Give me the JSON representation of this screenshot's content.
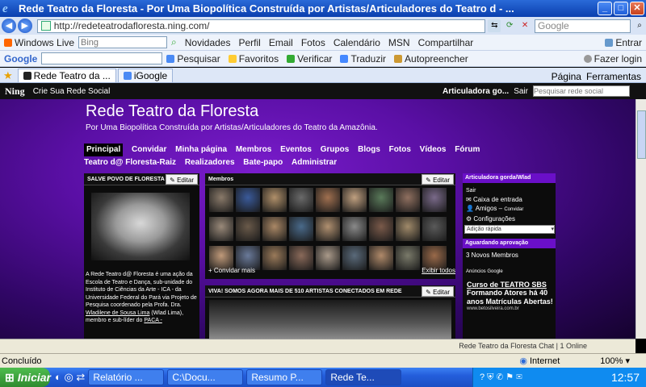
{
  "window": {
    "title": "Rede Teatro da Floresta - Por Uma Biopolítica Construída por Artistas/Articuladores do Teatro d - ..."
  },
  "address": {
    "url": "http://redeteatrodafloresta.ning.com/",
    "search_placeholder": "Google"
  },
  "toolbar1": {
    "brand": "Windows Live",
    "search_value": "Bing",
    "items": [
      "Novidades",
      "Perfil",
      "Email",
      "Fotos",
      "Calendário",
      "MSN",
      "Compartilhar"
    ],
    "enter": "Entrar"
  },
  "toolbar2": {
    "brand": "Google",
    "items": [
      "Pesquisar",
      "Favoritos",
      "Verificar",
      "Traduzir",
      "Autopreencher"
    ],
    "login": "Fazer login"
  },
  "tabs": [
    {
      "label": "Rede Teatro da ..."
    },
    {
      "label": "iGoogle"
    }
  ],
  "tab_tools": {
    "page": "Página",
    "tools": "Ferramentas"
  },
  "ningbar": {
    "logo": "Ning",
    "create": "Crie Sua Rede Social",
    "user": "Articuladora go...",
    "exit": "Sair",
    "search_placeholder": "Pesquisar rede social"
  },
  "site": {
    "title": "Rede Teatro da Floresta",
    "subtitle": "Por Uma Biopolítica Construída por Artistas/Articuladores do Teatro da Amazônia."
  },
  "nav": [
    "Principal",
    "Convidar",
    "Minha página",
    "Membros",
    "Eventos",
    "Grupos",
    "Blogs",
    "Fotos",
    "Vídeos",
    "Fórum",
    "Teatro d@ Floresta-Raiz",
    "Realizadores",
    "Bate-papo",
    "Administrar"
  ],
  "left_panel": {
    "header": "SALVE POVO DE FLORESTA SEJA",
    "edit": "Editar",
    "text_a": "A Rede Teatro d@ Floresta é uma ação da Escola de Teatro e Dança, sub-unidade do Instituto de Ciências da Arte - ICA - da Universidade Federal do Pará via Projeto de Pesquisa coordenado pela Profa. Dra. ",
    "link1": "Wladilene de Sousa Lima",
    "text_b": " (Wlad Lima), membro e sub-líder do ",
    "link2": "PACA -"
  },
  "members_panel": {
    "header": "Membros",
    "edit": "Editar",
    "invite": "+ Convidar mais",
    "show_all": "Exibir todos"
  },
  "feed_panel": {
    "header": "VIVA! SOMOS AGORA MAIS DE 510 ARTISTAS CONECTADOS EM REDE",
    "edit": "Editar"
  },
  "right_panel": {
    "header": "Articuladora gorda/Wlad",
    "exit": "Sair",
    "inbox": "Caixa de entrada",
    "friends": "Amigos",
    "invite": "Convidar",
    "settings": "Configurações",
    "quick_add": "Adição rápida",
    "approval_header": "Aguardando aprovação",
    "new_members": "3 Novos Membros",
    "ads": "Anúncios Google",
    "ad_title": "Curso de TEATRO SBS",
    "ad_text": "Formando Atores há 40 anos Matrículas Abertas!",
    "ad_url": "www.betosilveira.com.br"
  },
  "chat": {
    "label": "Rede Teatro da Floresta Chat | 1 Online"
  },
  "status": {
    "text": "Concluído",
    "zone": "Internet",
    "zoom": "100%"
  },
  "taskbar": {
    "start": "Iniciar",
    "tasks": [
      "Relatório ...",
      "C:\\Docu...",
      "Resumo P...",
      "Rede Te..."
    ],
    "clock": "12:57"
  },
  "colors": {
    "accent": "#6a0fc8",
    "title_bar": "#0a3fae"
  }
}
